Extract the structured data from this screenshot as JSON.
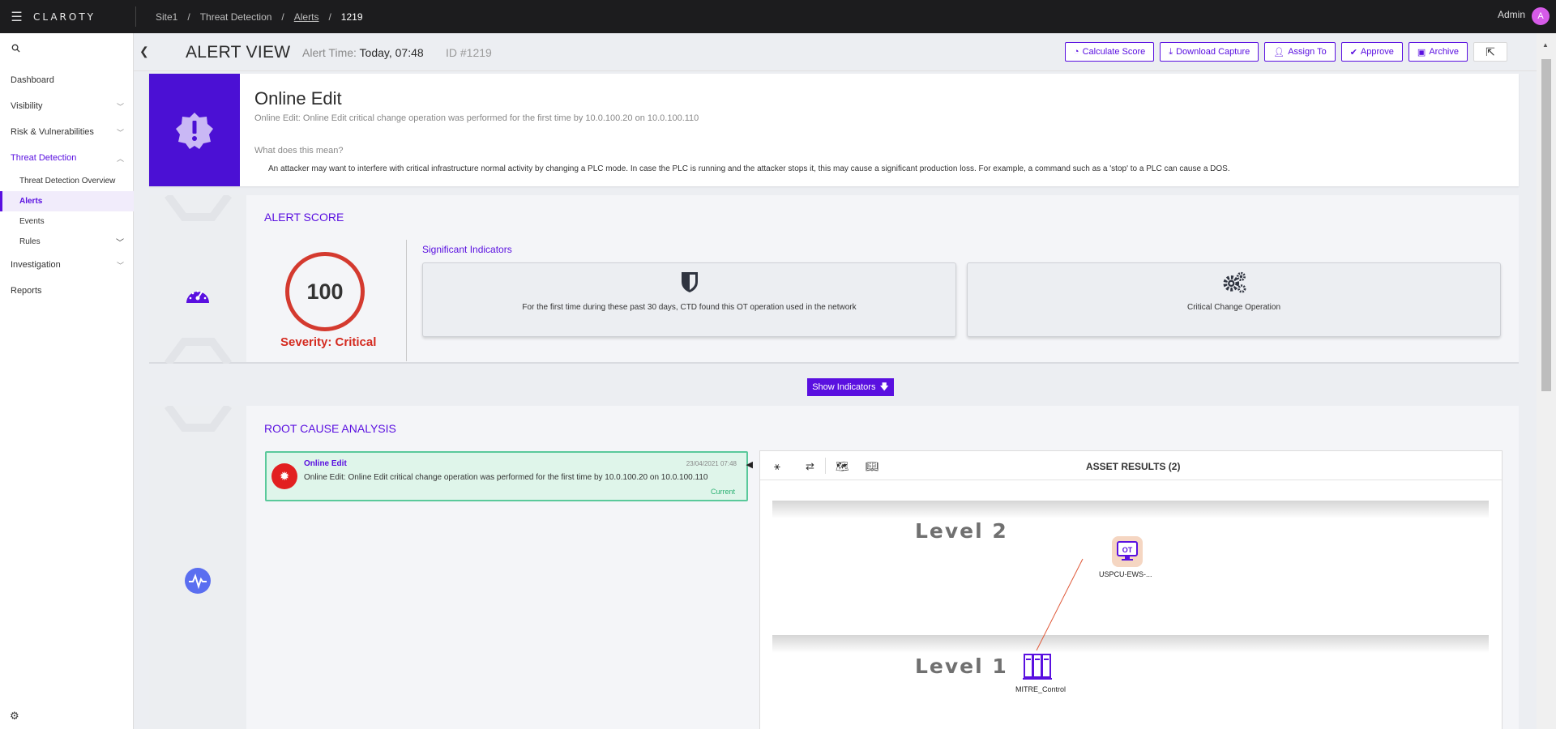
{
  "topbar": {
    "logo": "CLAROTY",
    "crumbs": [
      "Site1",
      "Threat Detection",
      "Alerts",
      "1219"
    ],
    "user": "Admin",
    "avatar": "A"
  },
  "sidebar": {
    "items": [
      {
        "label": "Dashboard"
      },
      {
        "label": "Visibility"
      },
      {
        "label": "Risk & Vulnerabilities"
      },
      {
        "label": "Threat Detection"
      },
      {
        "label": "Threat Detection Overview"
      },
      {
        "label": "Alerts"
      },
      {
        "label": "Events"
      },
      {
        "label": "Rules"
      },
      {
        "label": "Investigation"
      },
      {
        "label": "Reports"
      }
    ]
  },
  "header": {
    "title": "ALERT VIEW",
    "alert_time_label": "Alert Time:",
    "alert_time": "Today, 07:48",
    "id": "ID #1219",
    "buttons": {
      "calc": "Calculate Score",
      "download": "Download Capture",
      "assign": "Assign To",
      "approve": "Approve",
      "archive": "Archive"
    }
  },
  "alert": {
    "title": "Online Edit",
    "subtitle": "Online Edit: Online Edit critical change operation was performed for the first time by 10.0.100.20 on 10.0.100.110",
    "question": "What does this mean?",
    "description": "An attacker may want to interfere with critical infrastructure normal activity by changing a PLC mode. In case the PLC is running and the attacker stops it, this may cause a significant production loss. For example, a command such as a 'stop' to a PLC can cause a DOS."
  },
  "score": {
    "section_title": "ALERT SCORE",
    "value": "100",
    "severity": "Severity: Critical",
    "significant_label": "Significant Indicators",
    "indicators": [
      "For the first time during these past 30 days, CTD found this OT operation used in the network",
      "Critical Change Operation"
    ],
    "show_button": "Show Indicators"
  },
  "rca": {
    "section_title": "ROOT CAUSE ANALYSIS",
    "event": {
      "name": "Online Edit",
      "date": "23/04/2021 07:48",
      "message": "Online Edit: Online Edit critical change operation was performed for the first time by 10.0.100.20 on 10.0.100.110",
      "status": "Current"
    },
    "asset_results": "ASSET RESULTS (2)",
    "levels": [
      "Level 2",
      "Level 1"
    ],
    "assets": [
      {
        "label": "USPCU-EWS-...",
        "badge": "OT"
      },
      {
        "label": "MITRE_Control"
      }
    ]
  },
  "colors": {
    "accent": "#5a10e0",
    "critical": "#d42a1f",
    "current": "#2bb173"
  }
}
